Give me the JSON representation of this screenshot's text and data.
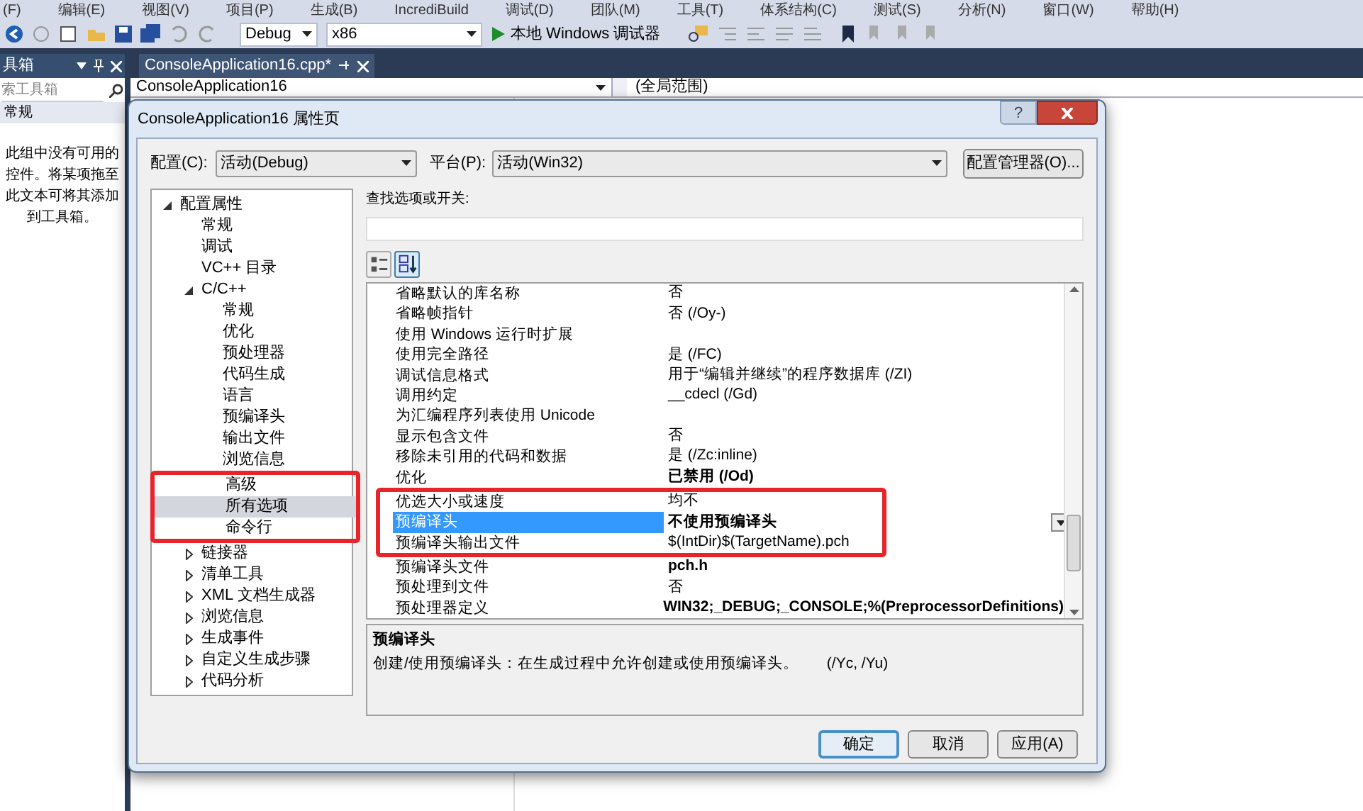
{
  "menu": [
    "(F)",
    "编辑(E)",
    "视图(V)",
    "项目(P)",
    "生成(B)",
    "IncrediBuild",
    "调试(D)",
    "团队(M)",
    "工具(T)",
    "体系结构(C)",
    "测试(S)",
    "分析(N)",
    "窗口(W)",
    "帮助(H)"
  ],
  "toolbar": {
    "config": "Debug",
    "platform": "x86",
    "run": "本地 Windows 调试器"
  },
  "toolbox": {
    "title": "具箱",
    "search_placeholder": "索工具箱",
    "group": "常规",
    "empty_text": "此组中没有可用的控件。将某项拖至此文本可将其添加到工具箱。"
  },
  "editor": {
    "tab": "ConsoleApplication16.cpp*",
    "scope_left": "ConsoleApplication16",
    "scope_right": "(全局范围)"
  },
  "dialog": {
    "title": "ConsoleApplication16 属性页",
    "help_button": "?",
    "config_label": "配置(C):",
    "config_value": "活动(Debug)",
    "platform_label": "平台(P):",
    "platform_value": "活动(Win32)",
    "manager_button": "配置管理器(O)...",
    "tree": [
      {
        "label": "配置属性",
        "expanded": true,
        "selected": false,
        "highlighted": false,
        "children": [
          {
            "label": "常规",
            "selected": false,
            "highlighted": false
          },
          {
            "label": "调试",
            "selected": false,
            "highlighted": false
          },
          {
            "label": "VC++ 目录",
            "selected": false,
            "highlighted": false
          },
          {
            "label": "C/C++",
            "expanded": true,
            "selected": false,
            "highlighted": false,
            "children": [
              {
                "label": "常规",
                "selected": false,
                "highlighted": false
              },
              {
                "label": "优化",
                "selected": false,
                "highlighted": false
              },
              {
                "label": "预处理器",
                "selected": false,
                "highlighted": false
              },
              {
                "label": "代码生成",
                "selected": false,
                "highlighted": false
              },
              {
                "label": "语言",
                "selected": false,
                "highlighted": false
              },
              {
                "label": "预编译头",
                "selected": false,
                "highlighted": false
              },
              {
                "label": "输出文件",
                "selected": false,
                "highlighted": false
              },
              {
                "label": "浏览信息",
                "selected": false,
                "highlighted": false
              },
              {
                "label": "高级",
                "selected": false,
                "highlighted": true
              },
              {
                "label": "所有选项",
                "selected": true,
                "highlighted": true
              },
              {
                "label": "命令行",
                "selected": false,
                "highlighted": true
              }
            ]
          },
          {
            "label": "链接器",
            "expanded": false,
            "selected": false,
            "highlighted": false
          },
          {
            "label": "清单工具",
            "expanded": false,
            "selected": false,
            "highlighted": false
          },
          {
            "label": "XML 文档生成器",
            "expanded": false,
            "selected": false,
            "highlighted": false
          },
          {
            "label": "浏览信息",
            "expanded": false,
            "selected": false,
            "highlighted": false
          },
          {
            "label": "生成事件",
            "expanded": false,
            "selected": false,
            "highlighted": false
          },
          {
            "label": "自定义生成步骤",
            "expanded": false,
            "selected": false,
            "highlighted": false
          },
          {
            "label": "代码分析",
            "expanded": false,
            "selected": false,
            "highlighted": false
          }
        ]
      }
    ],
    "search_label": "查找选项或开关:",
    "sort_modes": [
      {
        "kind": "categorized",
        "selected": false
      },
      {
        "kind": "alphabetical",
        "selected": true
      }
    ],
    "properties": [
      {
        "name": "省略默认的库名称",
        "value": "否",
        "modified": false,
        "selected": false,
        "highlighted": false
      },
      {
        "name": "省略帧指针",
        "value": "否 (/Oy-)",
        "modified": false,
        "selected": false,
        "highlighted": false
      },
      {
        "name": "使用 Windows 运行时扩展",
        "selected": false,
        "highlighted": false
      },
      {
        "name": "使用完全路径",
        "value": "是 (/FC)",
        "modified": false,
        "selected": false,
        "highlighted": false
      },
      {
        "name": "调试信息格式",
        "value": "用于“编辑并继续”的程序数据库 (/ZI)",
        "modified": false,
        "selected": false,
        "highlighted": false
      },
      {
        "name": "调用约定",
        "value": "__cdecl (/Gd)",
        "modified": false,
        "selected": false,
        "highlighted": false
      },
      {
        "name": "为汇编程序列表使用 Unicode",
        "selected": false,
        "highlighted": false
      },
      {
        "name": "显示包含文件",
        "value": "否",
        "modified": false,
        "selected": false,
        "highlighted": false
      },
      {
        "name": "移除未引用的代码和数据",
        "value": "是 (/Zc:inline)",
        "modified": false,
        "selected": false,
        "highlighted": false
      },
      {
        "name": "优化",
        "value": "已禁用 (/Od)",
        "modified": true,
        "selected": false,
        "highlighted": false
      },
      {
        "name": "优选大小或速度",
        "value": "均不",
        "modified": false,
        "selected": false,
        "highlighted": true
      },
      {
        "name": "预编译头",
        "value": "不使用预编译头",
        "modified": true,
        "selected": true,
        "highlighted": true
      },
      {
        "name": "预编译头输出文件",
        "value": "$(IntDir)$(TargetName).pch",
        "modified": false,
        "selected": false,
        "highlighted": true
      },
      {
        "name": "预编译头文件",
        "value": "pch.h",
        "modified": true,
        "selected": false,
        "highlighted": false
      },
      {
        "name": "预处理到文件",
        "value": "否",
        "modified": false,
        "selected": false,
        "highlighted": false
      },
      {
        "name": "预处理器定义",
        "value": "WIN32;_DEBUG;_CONSOLE;%(PreprocessorDefinitions)",
        "modified": true,
        "selected": false,
        "highlighted": false
      }
    ],
    "description": {
      "title": "预编译头",
      "text": "创建/使用预编译头：在生成过程中允许创建或使用预编译头。",
      "switches": "(/Yc, /Yu)"
    },
    "buttons": [
      {
        "label": "确定",
        "default": true
      },
      {
        "label": "取消",
        "default": false
      },
      {
        "label": "应用(A)",
        "default": false
      }
    ]
  }
}
